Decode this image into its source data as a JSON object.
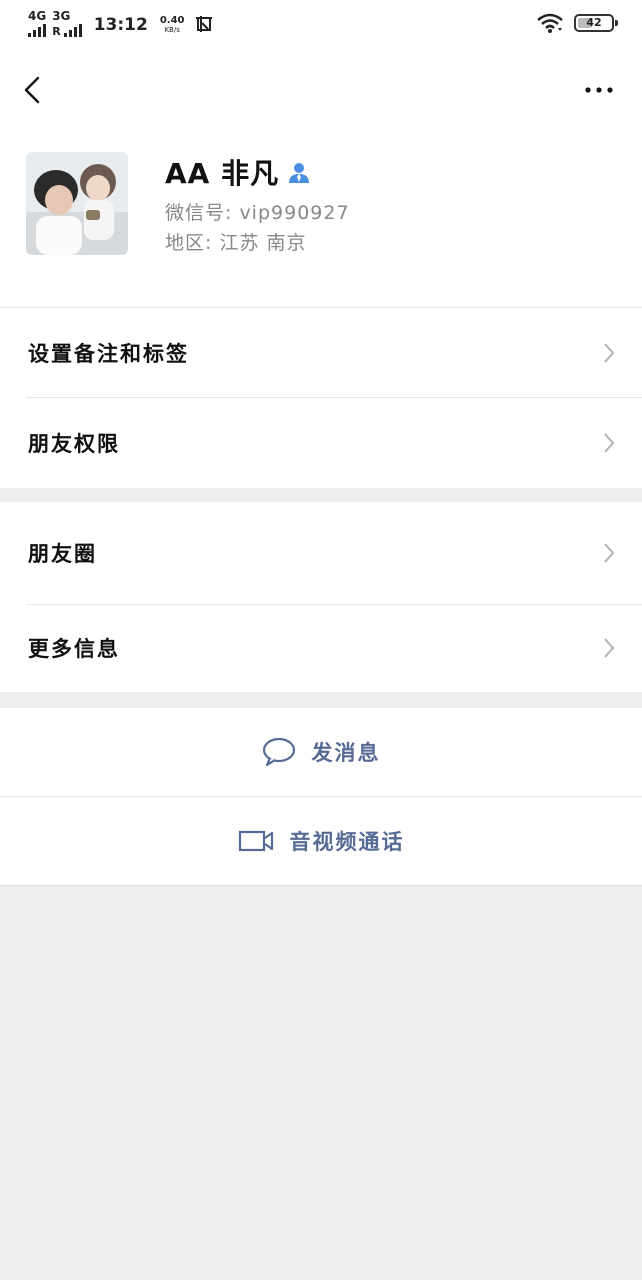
{
  "status_bar": {
    "network1": "4G",
    "network2": "3G",
    "roaming": "R",
    "time": "13:12",
    "speed_value": "0.40",
    "speed_unit": "KB/s",
    "battery_level": "42"
  },
  "navbar": {
    "back_icon": "chevron-left-icon",
    "more_icon": "more-dots-icon"
  },
  "profile": {
    "name": "AA 非凡",
    "wechat_id": "微信号: vip990927",
    "region": "地区: 江苏 南京"
  },
  "menu_group_1": {
    "items": [
      {
        "label": "设置备注和标签"
      },
      {
        "label": "朋友权限"
      }
    ]
  },
  "menu_group_2": {
    "items": [
      {
        "label": "朋友圈"
      },
      {
        "label": "更多信息"
      }
    ]
  },
  "actions": {
    "message_label": "发消息",
    "call_label": "音视频通话"
  },
  "colors": {
    "link_blue": "#576b95",
    "background_gray": "#ededed",
    "contact_icon_blue": "#4a8fe2"
  }
}
